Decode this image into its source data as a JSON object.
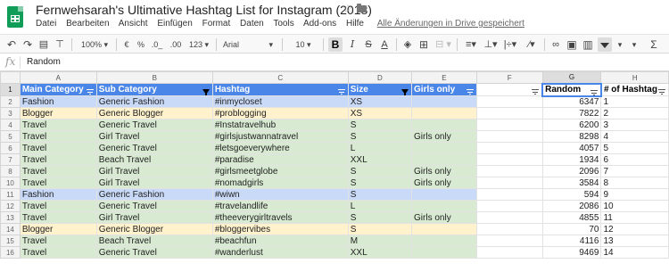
{
  "app": {
    "title": "Fernwehsarah's Ultimative Hashtag List for Instagram (2018)",
    "menu": [
      "Datei",
      "Bearbeiten",
      "Ansicht",
      "Einfügen",
      "Format",
      "Daten",
      "Tools",
      "Add-ons",
      "Hilfe"
    ],
    "saved_status": "Alle Änderungen in Drive gespeichert"
  },
  "toolbar": {
    "zoom": "100%",
    "currency": "€",
    "percent": "%",
    "decrease_decimals": ".0_",
    "increase_decimals": ".00",
    "more_formats": "123",
    "font": "Arial",
    "font_size": "10",
    "bold": "B",
    "italic": "I",
    "strike": "S",
    "text_color": "A",
    "sigma": "Σ"
  },
  "formula_bar": {
    "fx": "fx",
    "value": "Random"
  },
  "sheet": {
    "columns": [
      "A",
      "B",
      "C",
      "D",
      "E",
      "F",
      "G",
      "H"
    ],
    "headers": [
      "Main Category",
      "Sub Category",
      "Hashtag",
      "Size",
      "Girls only",
      "",
      "Random",
      "# of Hashtag"
    ],
    "rows": [
      {
        "n": "2",
        "cat": "fashion",
        "cells": [
          "Fashion",
          "Generic Fashion",
          "#inmycloset",
          "XS",
          "",
          "",
          "6347",
          "1"
        ]
      },
      {
        "n": "3",
        "cat": "blogger",
        "cells": [
          "Blogger",
          "Generic Blogger",
          "#problogging",
          "XS",
          "",
          "",
          "7822",
          "2"
        ]
      },
      {
        "n": "4",
        "cat": "travel",
        "cells": [
          "Travel",
          "Generic Travel",
          "#Instatravelhub",
          "S",
          "",
          "",
          "6200",
          "3"
        ]
      },
      {
        "n": "5",
        "cat": "travel",
        "cells": [
          "Travel",
          "Girl Travel",
          "#girlsjustwannatravel",
          "S",
          "Girls only",
          "",
          "8298",
          "4"
        ]
      },
      {
        "n": "6",
        "cat": "travel",
        "cells": [
          "Travel",
          "Generic Travel",
          "#letsgoeverywhere",
          "L",
          "",
          "",
          "4057",
          "5"
        ]
      },
      {
        "n": "7",
        "cat": "travel",
        "cells": [
          "Travel",
          "Beach Travel",
          "#paradise",
          "XXL",
          "",
          "",
          "1934",
          "6"
        ]
      },
      {
        "n": "8",
        "cat": "travel",
        "cells": [
          "Travel",
          "Girl Travel",
          "#girlsmeetglobe",
          "S",
          "Girls only",
          "",
          "2096",
          "7"
        ]
      },
      {
        "n": "10",
        "cat": "travel",
        "cells": [
          "Travel",
          "Girl Travel",
          "#nomadgirls",
          "S",
          "Girls only",
          "",
          "3584",
          "8"
        ]
      },
      {
        "n": "11",
        "cat": "fashion",
        "cells": [
          "Fashion",
          "Generic Fashion",
          "#wiwn",
          "S",
          "",
          "",
          "594",
          "9"
        ]
      },
      {
        "n": "12",
        "cat": "travel",
        "cells": [
          "Travel",
          "Generic Travel",
          "#travelandlife",
          "L",
          "",
          "",
          "2086",
          "10"
        ]
      },
      {
        "n": "13",
        "cat": "travel",
        "cells": [
          "Travel",
          "Girl Travel",
          "#theeverygirltravels",
          "S",
          "Girls only",
          "",
          "4855",
          "11"
        ]
      },
      {
        "n": "14",
        "cat": "blogger",
        "cells": [
          "Blogger",
          "Generic Blogger",
          "#bloggervibes",
          "S",
          "",
          "",
          "70",
          "12"
        ]
      },
      {
        "n": "15",
        "cat": "travel",
        "cells": [
          "Travel",
          "Beach Travel",
          "#beachfun",
          "M",
          "",
          "",
          "4116",
          "13"
        ]
      },
      {
        "n": "16",
        "cat": "travel",
        "cells": [
          "Travel",
          "Generic Travel",
          "#wanderlust",
          "XXL",
          "",
          "",
          "9469",
          "14"
        ]
      }
    ]
  },
  "colors": {
    "header_blue": "#4a86e8",
    "travel_green": "#d9ead3",
    "fashion_blue": "#c9daf8",
    "blogger_yellow": "#fff2cc",
    "sheets_green": "#0f9d58"
  }
}
